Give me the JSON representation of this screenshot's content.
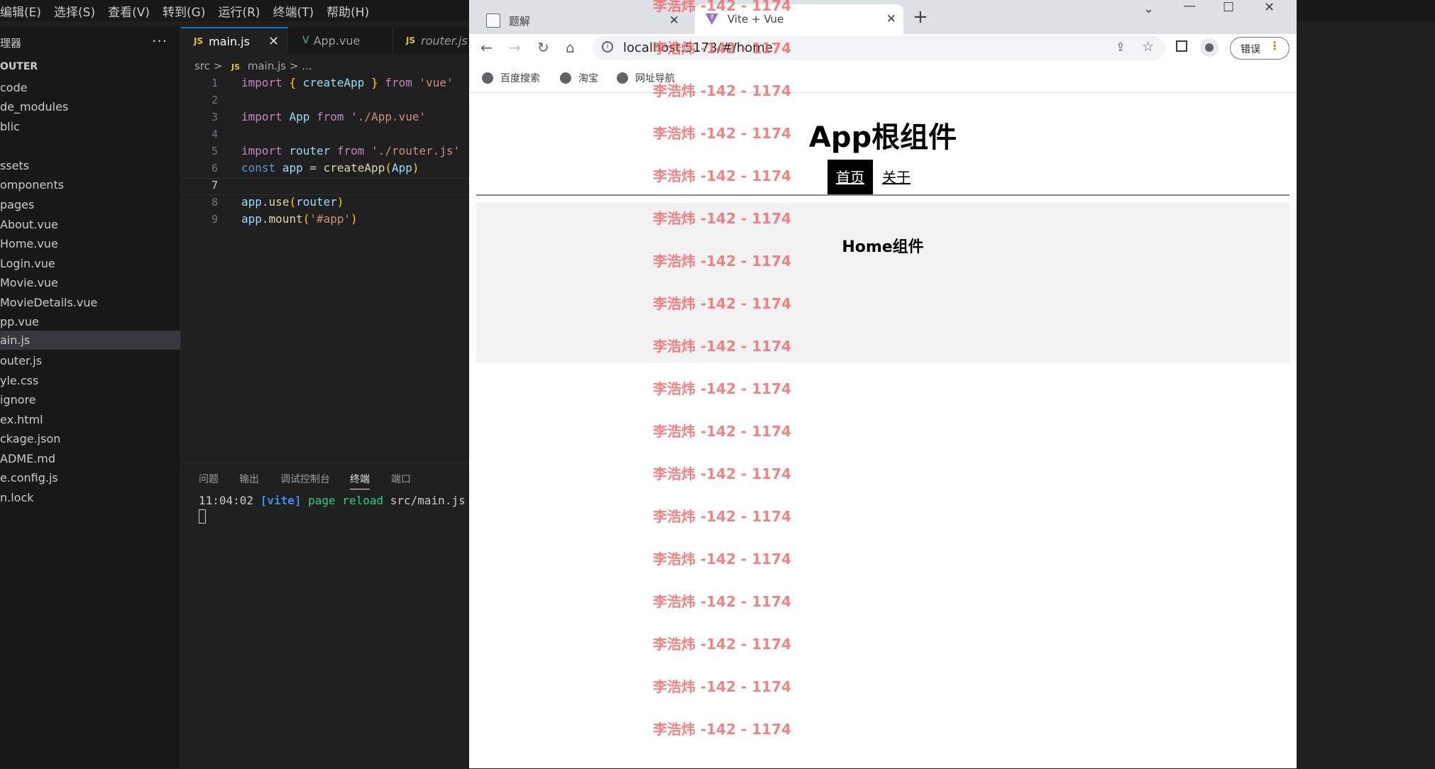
{
  "vscode": {
    "menu": [
      "编辑(E)",
      "选择(S)",
      "查看(V)",
      "转到(G)",
      "运行(R)",
      "终端(T)",
      "帮助(H)"
    ],
    "explorer_title": "理器",
    "explorer_more": "···",
    "project_root": "OUTER",
    "tree": [
      "code",
      "de_modules",
      "blic",
      "",
      "ssets",
      "omponents",
      "pages",
      "About.vue",
      "Home.vue",
      "Login.vue",
      "Movie.vue",
      "MovieDetails.vue",
      "pp.vue",
      "ain.js",
      "outer.js",
      "yle.css",
      "ignore",
      "ex.html",
      "ckage.json",
      "ADME.md",
      "e.config.js",
      "n.lock"
    ],
    "tabs": [
      {
        "label": "main.js",
        "icon": "JS",
        "close": "✕"
      },
      {
        "label": "App.vue",
        "icon": "V"
      },
      {
        "label": "router.js",
        "icon": "JS"
      }
    ],
    "breadcrumb": {
      "folder": "src",
      "sep": ">",
      "file": "main.js",
      "rest": "> ..."
    },
    "line_numbers": [
      "1",
      "2",
      "3",
      "4",
      "5",
      "6",
      "7",
      "8",
      "9"
    ],
    "code_lines": [
      "import { createApp } from 'vue'",
      "",
      "import App from './App.vue'",
      "",
      "import router from './router.js'",
      "const app = createApp(App)",
      "",
      "app.use(router)",
      "app.mount('#app')"
    ],
    "panel_tabs": [
      "问题",
      "输出",
      "调试控制台",
      "终端",
      "端口"
    ],
    "terminal": {
      "time": "11:04:02",
      "tag": "[vite]",
      "msg": "page reload",
      "file": "src/main.js"
    }
  },
  "browser": {
    "tabs": [
      {
        "title": "题解",
        "close": "✕"
      },
      {
        "title": "Vite + Vue",
        "close": "✕"
      }
    ],
    "new_tab": "+",
    "window_controls": {
      "minimize": "—",
      "maximize": "☐",
      "close": "✕",
      "dropdown": "⌄"
    },
    "url": "localhost:5173/#/home",
    "error_button": "错误",
    "bookmarks": [
      "百度搜索",
      "淘宝",
      "网址导航"
    ],
    "page": {
      "title": "App根组件",
      "nav": [
        "首页",
        "关于"
      ],
      "home_title": "Home组件"
    }
  },
  "watermark": {
    "text": "李浩炜 -142 - 1174",
    "count": 18
  }
}
